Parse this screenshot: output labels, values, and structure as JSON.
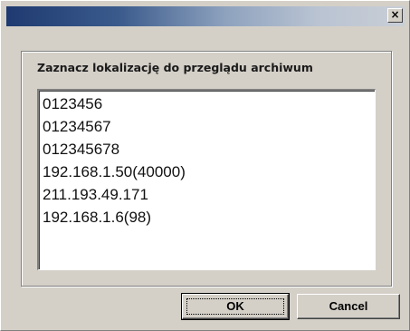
{
  "window": {
    "close_glyph": "×"
  },
  "dialog": {
    "prompt": "Zaznacz lokalizację do przeglądu archiwum",
    "items": [
      "0123456",
      "01234567",
      "012345678",
      "192.168.1.50(40000)",
      "211.193.49.171",
      "192.168.1.6(98)"
    ]
  },
  "buttons": {
    "ok_label": "OK",
    "cancel_label": "Cancel"
  }
}
